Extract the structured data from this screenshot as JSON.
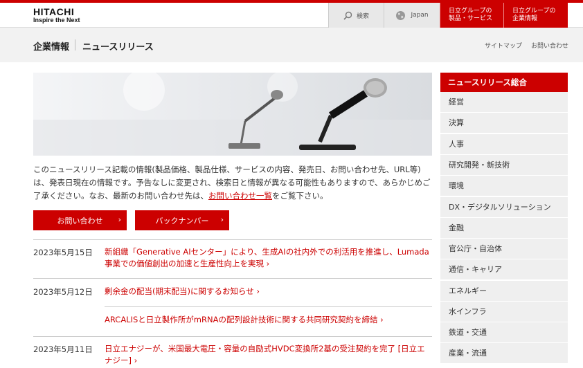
{
  "header": {
    "logo_main": "HITACHI",
    "logo_sub": "Inspire the Next",
    "search_label": "検索",
    "region_label": "Japan",
    "products_label_1": "日立グループの",
    "products_label_2": "製品・サービス",
    "corporate_label_1": "日立グループの",
    "corporate_label_2": "企業情報"
  },
  "breadcrumb": {
    "parent": "企業情報",
    "current": "ニュースリリース"
  },
  "sublinks": {
    "sitemap": "サイトマップ",
    "contact": "お問い合わせ"
  },
  "intro": {
    "text_before": "このニュースリリース記載の情報(製品価格、製品仕様、サービスの内容、発売日、お問い合わせ先、URL等)は、発表日現在の情報です。予告なしに変更され、検索日と情報が異なる可能性もありますので、あらかじめご了承ください。なお、最新のお問い合わせ先は、",
    "link_text": "お問い合わせ一覧",
    "text_after": "をご覧下さい。"
  },
  "buttons": {
    "contact": "お問い合わせ",
    "backnumber": "バックナンバー"
  },
  "news": [
    {
      "date": "2023年5月15日",
      "title": "新組織「Generative AIセンター」により、生成AIの社内外での利活用を推進し、Lumada事業での価値創出の加速と生産性向上を実現"
    },
    {
      "date": "2023年5月12日",
      "title": "剰余金の配当(期末配当)に関するお知らせ"
    },
    {
      "date": "",
      "title": "ARCALISと日立製作所がmRNAの配列設計技術に関する共同研究契約を締結"
    },
    {
      "date": "2023年5月11日",
      "title": "日立エナジーが、米国最大電圧・容量の自励式HVDC変換所2基の受注契約を完了 [日立エナジー]"
    }
  ],
  "sidebar": {
    "title": "ニュースリリース総合",
    "items": [
      "経営",
      "決算",
      "人事",
      "研究開発・新技術",
      "環境",
      "DX・デジタルソリューション",
      "金融",
      "官公庁・自治体",
      "通信・キャリア",
      "エネルギー",
      "水インフラ",
      "鉄道・交通",
      "産業・流通"
    ]
  },
  "colors": {
    "brand_red": "#cc0000",
    "link_red": "#c00"
  }
}
